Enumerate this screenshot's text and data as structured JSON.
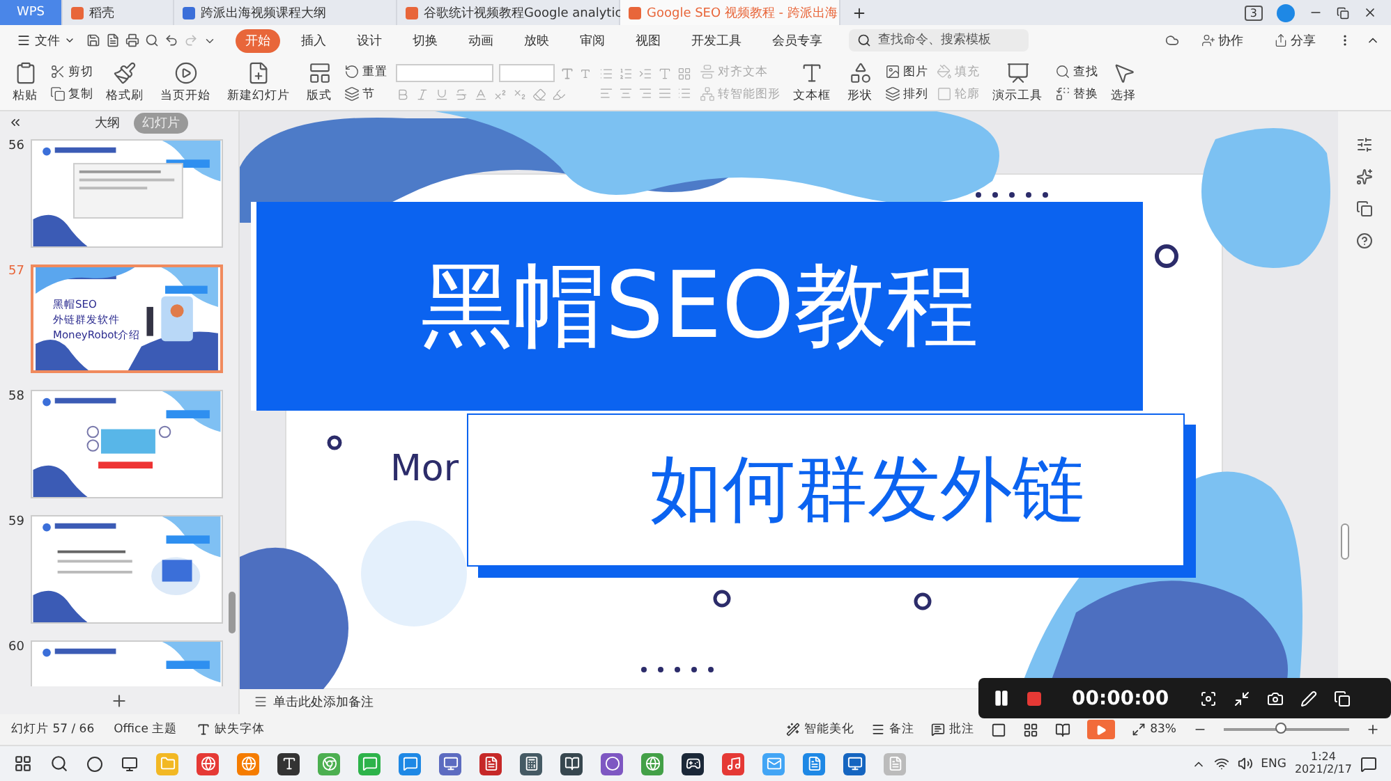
{
  "title_bar": {
    "tabs": [
      {
        "label": "WPS",
        "kind": "home",
        "selected": false
      },
      {
        "label": "稻壳",
        "kind": "docer",
        "selected": false
      },
      {
        "label": "跨派出海视频课程大纲",
        "kind": "doc",
        "selected": false
      },
      {
        "label": "谷歌统计视频教程Google analytic",
        "kind": "ppt",
        "selected": false
      },
      {
        "label": "Google SEO 视频教程 - 跨派出海",
        "kind": "ppt",
        "selected": true
      }
    ],
    "badge": "3"
  },
  "menu": {
    "file": "文件",
    "tabs": [
      {
        "label": "开始",
        "selected": true
      },
      {
        "label": "插入",
        "selected": false
      },
      {
        "label": "设计",
        "selected": false
      },
      {
        "label": "切换",
        "selected": false
      },
      {
        "label": "动画",
        "selected": false
      },
      {
        "label": "放映",
        "selected": false
      },
      {
        "label": "审阅",
        "selected": false
      },
      {
        "label": "视图",
        "selected": false
      },
      {
        "label": "开发工具",
        "selected": false
      },
      {
        "label": "会员专享",
        "selected": false
      }
    ],
    "search": {
      "placeholder": "查找命令、搜索模板"
    },
    "actions": [
      "协作",
      "分享"
    ]
  },
  "ribbon": {
    "groups": [
      {
        "kind": "large",
        "label": "粘贴"
      },
      {
        "kind": "stack",
        "items": [
          {
            "label": "剪切",
            "disabled": false
          },
          {
            "label": "复制",
            "disabled": false
          }
        ]
      },
      {
        "kind": "large",
        "label": "格式刷"
      },
      {
        "kind": "large",
        "label": "当页开始"
      },
      {
        "kind": "large",
        "label": "新建幻灯片"
      },
      {
        "kind": "large",
        "label": "版式"
      },
      {
        "kind": "stack",
        "items": [
          {
            "label": "重置",
            "disabled": false
          },
          {
            "label": "节",
            "disabled": false
          }
        ]
      },
      {
        "kind": "font"
      },
      {
        "kind": "paragraph"
      },
      {
        "kind": "stack",
        "items": [
          {
            "label": "对齐文本",
            "disabled": true
          },
          {
            "label": "转智能图形",
            "disabled": true
          }
        ]
      },
      {
        "kind": "large",
        "label": "文本框"
      },
      {
        "kind": "large",
        "label": "形状"
      },
      {
        "kind": "stack",
        "items": [
          {
            "label": "图片",
            "disabled": false
          },
          {
            "label": "排列",
            "disabled": false
          }
        ]
      },
      {
        "kind": "stack",
        "items": [
          {
            "label": "填充",
            "disabled": true
          },
          {
            "label": "轮廓",
            "disabled": true
          }
        ]
      },
      {
        "kind": "large",
        "label": "演示工具"
      },
      {
        "kind": "stack",
        "items": [
          {
            "label": "查找",
            "disabled": false
          },
          {
            "label": "替换",
            "disabled": false
          }
        ]
      },
      {
        "kind": "large",
        "label": "选择"
      }
    ]
  },
  "slide_panel": {
    "views": [
      {
        "label": "大纲",
        "selected": false
      },
      {
        "label": "幻灯片",
        "selected": true
      }
    ],
    "slides": [
      {
        "number": "56",
        "selected": false
      },
      {
        "number": "57",
        "selected": true,
        "lines": [
          "黑帽SEO",
          "外链群发软件",
          "MoneyRobot介绍"
        ]
      },
      {
        "number": "58",
        "selected": false
      },
      {
        "number": "59",
        "selected": false
      },
      {
        "number": "60",
        "selected": false
      }
    ]
  },
  "slide": {
    "title": "黑帽SEO教程",
    "subtitle": "如何群发外链",
    "partial_text": "Mor"
  },
  "notes": {
    "placeholder": "单击此处添加备注"
  },
  "recorder": {
    "time": "00:00:00"
  },
  "status_bar": {
    "slide_count": "幻灯片 57 / 66",
    "theme": "Office 主题",
    "missing_fonts": "缺失字体",
    "beautify": "智能美化",
    "notes": "备注",
    "comments": "批注",
    "zoom": "83%",
    "zoom_level": {
      "level": 0.45
    }
  },
  "taskbar": {
    "language": "ENG",
    "time": "1:24",
    "date": "2021/2/17"
  }
}
